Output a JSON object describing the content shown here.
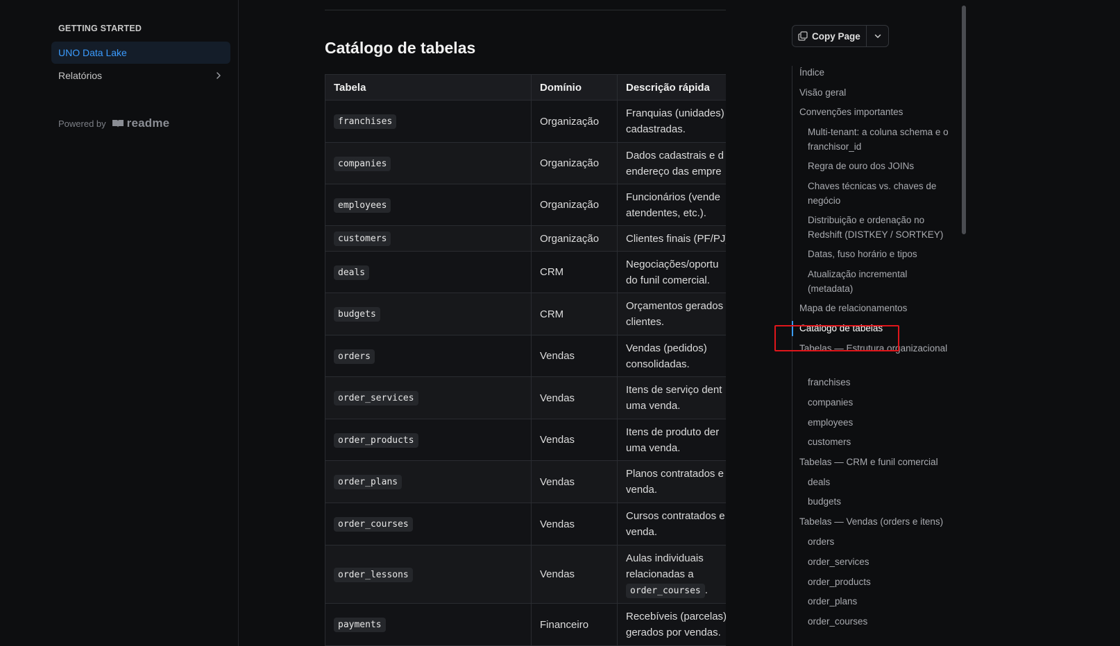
{
  "sidebar": {
    "heading": "GETTING STARTED",
    "items": [
      {
        "label": "UNO Data Lake",
        "active": true
      },
      {
        "label": "Relatórios",
        "active": false
      }
    ],
    "powered_by": "Powered by",
    "brand": "readme"
  },
  "main": {
    "section_title": "Catálogo de tabelas",
    "table": {
      "headers": [
        "Tabela",
        "Domínio",
        "Descrição rápida"
      ],
      "rows": [
        {
          "name": "franchises",
          "domain": "Organização",
          "desc1": "Franquias (unidades)",
          "desc2": "cadastradas."
        },
        {
          "name": "companies",
          "domain": "Organização",
          "desc1": "Dados cadastrais e d",
          "desc2": "endereço das empre"
        },
        {
          "name": "employees",
          "domain": "Organização",
          "desc1": "Funcionários (vende",
          "desc2": "atendentes, etc.)."
        },
        {
          "name": "customers",
          "domain": "Organização",
          "desc1": "Clientes finais (PF/PJ)",
          "desc2": ""
        },
        {
          "name": "deals",
          "domain": "CRM",
          "desc1": "Negociações/oportu",
          "desc2": "do funil comercial."
        },
        {
          "name": "budgets",
          "domain": "CRM",
          "desc1": "Orçamentos gerados",
          "desc2": "clientes."
        },
        {
          "name": "orders",
          "domain": "Vendas",
          "desc1": "Vendas (pedidos)",
          "desc2": "consolidadas."
        },
        {
          "name": "order_services",
          "domain": "Vendas",
          "desc1": "Itens de serviço dent",
          "desc2": "uma venda."
        },
        {
          "name": "order_products",
          "domain": "Vendas",
          "desc1": "Itens de produto der",
          "desc2": "uma venda."
        },
        {
          "name": "order_plans",
          "domain": "Vendas",
          "desc1": "Planos contratados e",
          "desc2": "venda."
        },
        {
          "name": "order_courses",
          "domain": "Vendas",
          "desc1": "Cursos contratados e",
          "desc2": "venda."
        },
        {
          "name": "order_lessons",
          "domain": "Vendas",
          "desc1": "Aulas individuais",
          "desc2": "relacionadas a",
          "desc3_code": "order_courses",
          "desc3_suffix": "."
        },
        {
          "name": "payments",
          "domain": "Financeiro",
          "desc1": "Recebíveis (parcelas)",
          "desc2": "gerados por vendas."
        }
      ]
    }
  },
  "copy_page": {
    "label": "Copy Page"
  },
  "toc": {
    "items": [
      {
        "label": "Índice",
        "level": 1
      },
      {
        "label": "Visão geral",
        "level": 1
      },
      {
        "label": "Convenções importantes",
        "level": 1
      },
      {
        "label": "Multi-tenant: a coluna schema e o franchisor_id",
        "level": 2
      },
      {
        "label": "Regra de ouro dos JOINs",
        "level": 2
      },
      {
        "label": "Chaves técnicas vs. chaves de negócio",
        "level": 2
      },
      {
        "label": "Distribuição e ordenação no Redshift (DISTKEY / SORTKEY)",
        "level": 2
      },
      {
        "label": "Datas, fuso horário e tipos",
        "level": 2
      },
      {
        "label": "Atualização incremental (metadata)",
        "level": 2
      },
      {
        "label": "Mapa de relacionamentos",
        "level": 1
      },
      {
        "label": "Catálogo de tabelas",
        "level": 1,
        "current": true
      },
      {
        "label": "Tabelas — Estrutura organizacional",
        "level": 1
      },
      {
        "label": "franchises",
        "level": 2
      },
      {
        "label": "companies",
        "level": 2
      },
      {
        "label": "employees",
        "level": 2
      },
      {
        "label": "customers",
        "level": 2
      },
      {
        "label": "Tabelas — CRM e funil comercial",
        "level": 1
      },
      {
        "label": "deals",
        "level": 2
      },
      {
        "label": "budgets",
        "level": 2
      },
      {
        "label": "Tabelas — Vendas (orders e itens)",
        "level": 1
      },
      {
        "label": "orders",
        "level": 2
      },
      {
        "label": "order_services",
        "level": 2
      },
      {
        "label": "order_products",
        "level": 2
      },
      {
        "label": "order_plans",
        "level": 2
      },
      {
        "label": "order_courses",
        "level": 2
      }
    ]
  },
  "colors": {
    "accent": "#3b9cff",
    "highlight_box": "#e0161b",
    "background": "#0d0e10"
  }
}
